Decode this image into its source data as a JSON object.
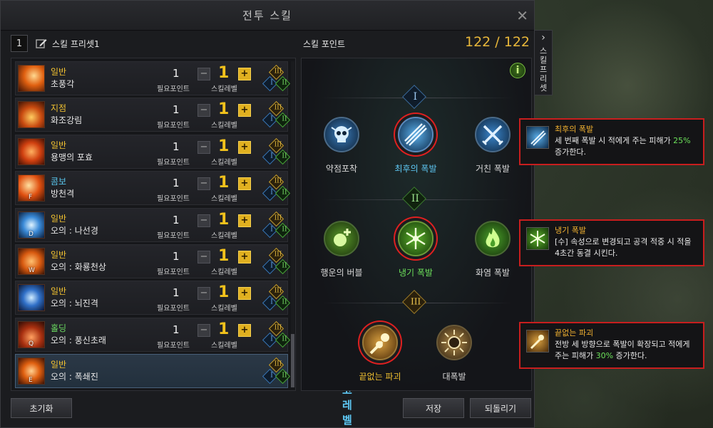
{
  "window": {
    "title": "전투 스킬",
    "close_glyph": "✕"
  },
  "preset": {
    "number": "1",
    "name": "스킬 프리셋1"
  },
  "skill_points": {
    "label": "스킬 포인트",
    "value": "122 / 122"
  },
  "labels": {
    "required_points": "필요포인트",
    "skill_level": "스킬레벨",
    "max_level": "최고레벨",
    "minus": "−",
    "plus": "+"
  },
  "skills": [
    {
      "type": "일반",
      "type_color": "#f0c030",
      "name": "초풍각",
      "req": "1",
      "level": "1",
      "key": ""
    },
    {
      "type": "지점",
      "type_color": "#f0c030",
      "name": "화조강림",
      "req": "1",
      "level": "1",
      "key": ""
    },
    {
      "type": "일반",
      "type_color": "#f0c030",
      "name": "용맹의 포효",
      "req": "1",
      "level": "1",
      "key": ""
    },
    {
      "type": "콤보",
      "type_color": "#5ac8f0",
      "name": "방천격",
      "req": "1",
      "level": "1",
      "key": "F"
    },
    {
      "type": "일반",
      "type_color": "#f0c030",
      "name": "오의 : 나선경",
      "req": "1",
      "level": "1",
      "key": "D"
    },
    {
      "type": "일반",
      "type_color": "#f0c030",
      "name": "오의 : 화룡천상",
      "req": "1",
      "level": "1",
      "key": "W"
    },
    {
      "type": "일반",
      "type_color": "#f0c030",
      "name": "오의 : 뇌진격",
      "req": "1",
      "level": "1",
      "key": ""
    },
    {
      "type": "홀딩",
      "type_color": "#6ad860",
      "name": "오의 : 풍신초래",
      "req": "1",
      "level": "1",
      "key": "Q"
    },
    {
      "type": "일반",
      "type_color": "#f0c030",
      "name": "오의 : 폭쇄진",
      "req": "",
      "level": "",
      "key": "E"
    }
  ],
  "tripods": {
    "tier1": {
      "numeral": "I",
      "items": [
        {
          "label": "약점포착"
        },
        {
          "label": "최후의 폭발"
        },
        {
          "label": "거친 폭발"
        }
      ]
    },
    "tier2": {
      "numeral": "II",
      "items": [
        {
          "label": "행운의 버블"
        },
        {
          "label": "냉기 폭발"
        },
        {
          "label": "화염 폭발"
        }
      ]
    },
    "tier3": {
      "numeral": "III",
      "items": [
        {
          "label": "끝없는 파괴"
        },
        {
          "label": "대폭발"
        }
      ]
    },
    "info_glyph": "i"
  },
  "diamonds": {
    "t3": "III",
    "t1": "I",
    "t2": "II"
  },
  "buttons": {
    "reset": "초기화",
    "save": "저장",
    "revert": "되돌리기"
  },
  "side_tab": {
    "arrow": "›",
    "label": "스킬프리셋"
  },
  "tooltips": [
    {
      "name": "최후의 폭발",
      "text_a": "세 번째 폭발 시 적에게 주는 피해가 ",
      "highlight": "25%",
      "text_b": " 증가한다."
    },
    {
      "name": "냉기 폭발",
      "text_a": "[수] 속성으로 변경되고 공격 적중 시 적을 4초간 동결 시킨다.",
      "highlight": "",
      "text_b": ""
    },
    {
      "name": "끝없는 파괴",
      "text_a": "전방 세 방향으로 폭발이 확장되고 적에게 주는 피해가 ",
      "highlight": "30%",
      "text_b": " 증가한다."
    }
  ]
}
